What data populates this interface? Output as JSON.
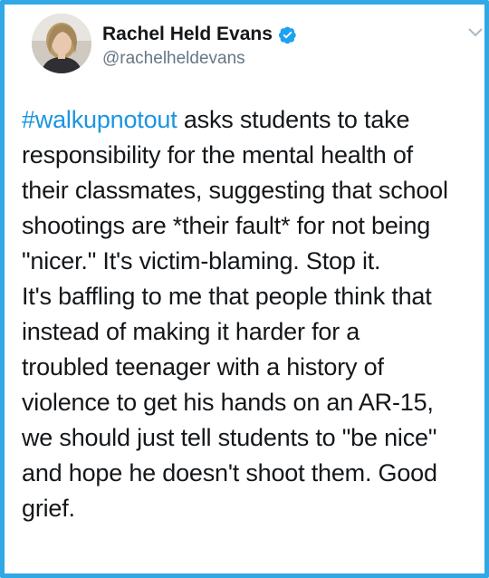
{
  "frame": {
    "border_color": "#31a8e6"
  },
  "author": {
    "display_name": "Rachel Held Evans",
    "handle": "@rachelheldevans",
    "verified": true
  },
  "icons": {
    "verified": "verified-badge-icon",
    "menu": "chevron-down-icon"
  },
  "tweet": {
    "hashtag": "#walkupnotout",
    "lines": [
      " asks students to take",
      "responsibility for the mental health of",
      "their classmates, suggesting that school",
      "shootings are *their fault* for not being",
      "\"nicer.\" It's victim-blaming. Stop it.",
      "It's baffling to me that people think that",
      "instead of making it harder for a",
      "troubled teenager with a history of",
      "violence to get his hands on an AR-15,",
      "we should just tell students to \"be nice\"",
      "and hope he doesn't shoot them. Good",
      "grief."
    ]
  },
  "colors": {
    "text": "#14171a",
    "handle": "#657786",
    "hashtag": "#1b95e0",
    "verified": "#1da1f2"
  }
}
